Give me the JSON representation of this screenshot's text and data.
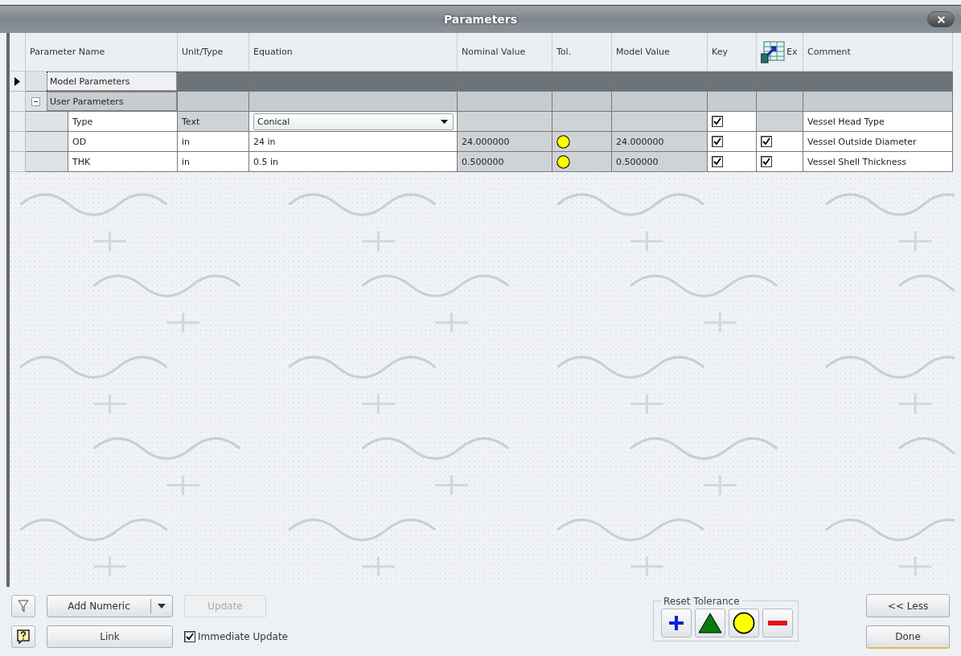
{
  "window": {
    "title": "Parameters"
  },
  "columns": [
    {
      "label": "Parameter Name"
    },
    {
      "label": "Unit/Type"
    },
    {
      "label": "Equation"
    },
    {
      "label": "Nominal Value"
    },
    {
      "label": "Tol."
    },
    {
      "label": "Model Value"
    },
    {
      "label": "Key"
    },
    {
      "label": "Ex",
      "kind": "icon"
    },
    {
      "label": "Comment"
    }
  ],
  "groups": [
    {
      "name": "Model Parameters",
      "selected": true,
      "expanded": false
    },
    {
      "name": "User Parameters",
      "selected": false,
      "expanded": true,
      "children": [
        {
          "kind": "text",
          "name": "Type",
          "unit": "Text",
          "equation": "Conical",
          "key": true,
          "comment": "Vessel Head Type"
        },
        {
          "kind": "numeric",
          "name": "OD",
          "unit": "in",
          "equation": "24 in",
          "nominal": "24.000000",
          "tolerance": {
            "kind": "circle"
          },
          "model_value": "24.000000",
          "key": true,
          "export": true,
          "comment": "Vessel Outside Diameter"
        },
        {
          "kind": "numeric",
          "name": "THK",
          "unit": "in",
          "equation": "0.5 in",
          "nominal": "0.500000",
          "tolerance": {
            "kind": "circle"
          },
          "model_value": "0.500000",
          "key": true,
          "export": true,
          "comment": "Vessel Shell Thickness"
        }
      ]
    }
  ],
  "bottom": {
    "add_button": "Add Numeric",
    "update_button": {
      "label": "Update",
      "disabled": true
    },
    "link_button": "Link",
    "immediate_update": {
      "label": "Immediate Update",
      "checked": true
    },
    "reset_tolerance": {
      "title": "Reset Tolerance",
      "buttons": [
        {
          "kind": "plus"
        },
        {
          "kind": "triangle"
        },
        {
          "kind": "circle"
        },
        {
          "kind": "minus"
        }
      ]
    },
    "less_button": "<< Less",
    "done_button": "Done"
  }
}
